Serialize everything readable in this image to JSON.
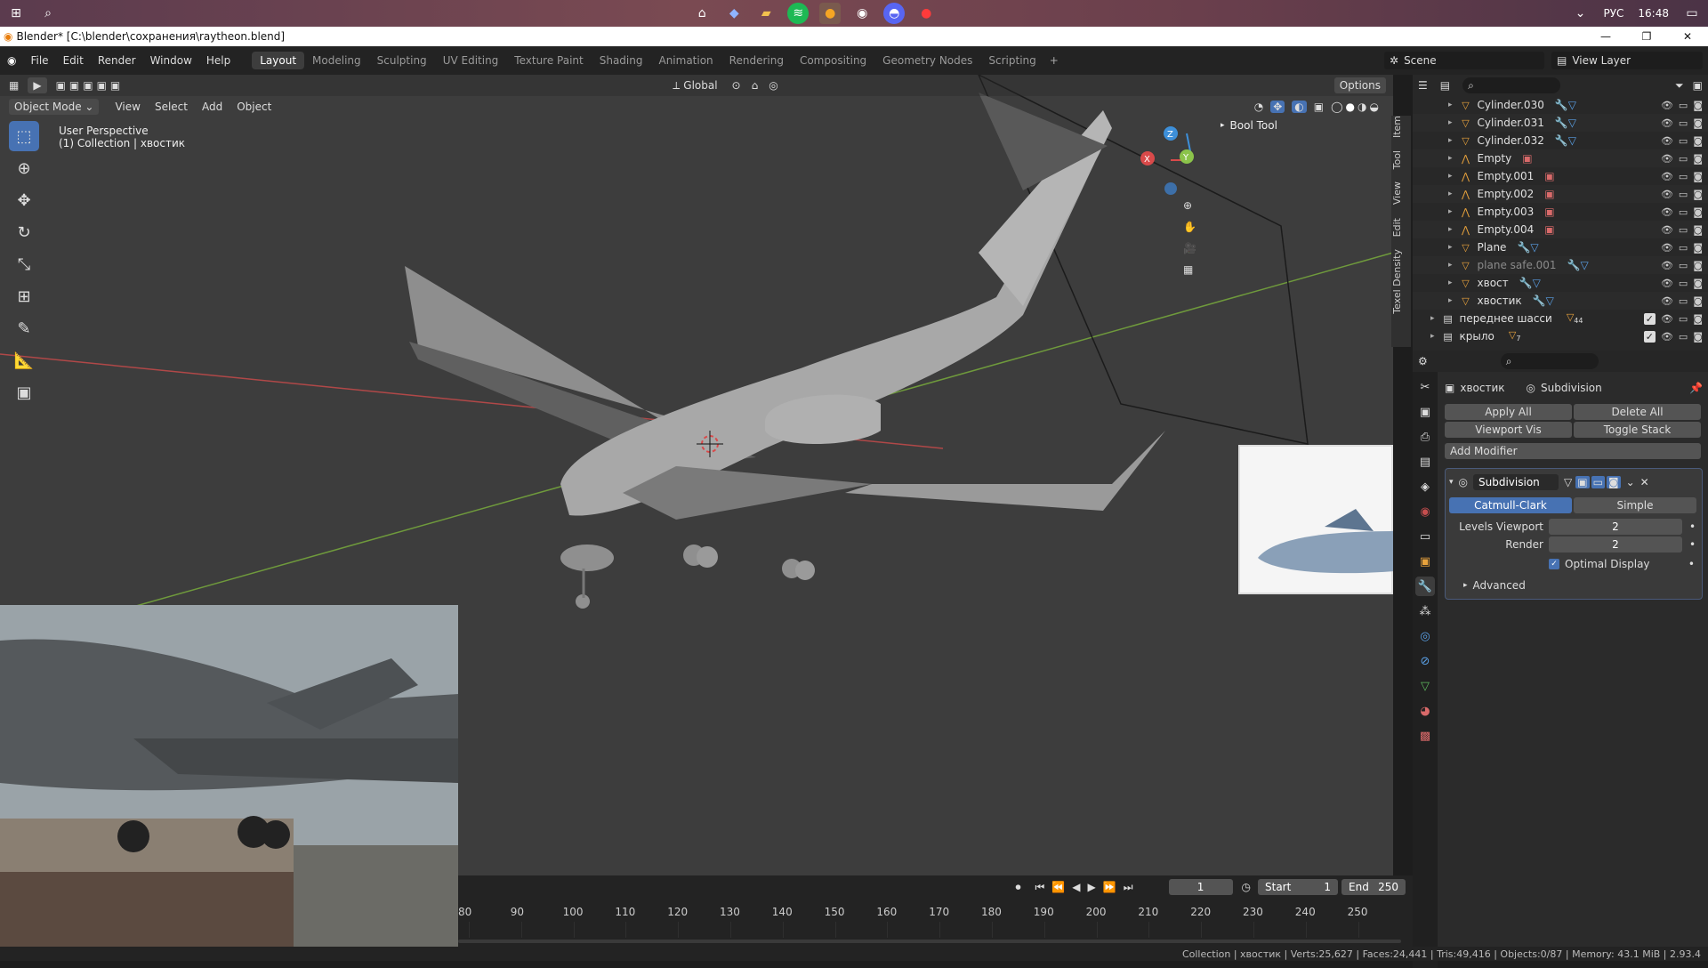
{
  "taskbar": {
    "lang": "РУС",
    "time": "16:48"
  },
  "window": {
    "title": "Blender* [C:\\blender\\сохранения\\raytheon.blend]"
  },
  "menu": [
    "File",
    "Edit",
    "Render",
    "Window",
    "Help"
  ],
  "workspaces": [
    "Layout",
    "Modeling",
    "Sculpting",
    "UV Editing",
    "Texture Paint",
    "Shading",
    "Animation",
    "Rendering",
    "Compositing",
    "Geometry Nodes",
    "Scripting"
  ],
  "scene": {
    "scene_name": "Scene",
    "view_layer": "View Layer"
  },
  "viewport": {
    "transform": "Global",
    "options": "Options",
    "mode": "Object Mode",
    "menu": [
      "View",
      "Select",
      "Add",
      "Object"
    ],
    "info_line1": "User Perspective",
    "info_line2": "(1) Collection | хвостик",
    "bool_tool": "Bool Tool",
    "side_tabs": [
      "Item",
      "Tool",
      "View",
      "Edit",
      "Texel Density"
    ],
    "gizmo": {
      "x": "X",
      "y": "Y",
      "z": "Z"
    }
  },
  "outliner": {
    "rows": [
      {
        "name": "Cylinder.030",
        "type": "mesh"
      },
      {
        "name": "Cylinder.031",
        "type": "mesh"
      },
      {
        "name": "Cylinder.032",
        "type": "mesh"
      },
      {
        "name": "Empty",
        "type": "empty"
      },
      {
        "name": "Empty.001",
        "type": "empty"
      },
      {
        "name": "Empty.002",
        "type": "empty"
      },
      {
        "name": "Empty.003",
        "type": "empty"
      },
      {
        "name": "Empty.004",
        "type": "empty"
      },
      {
        "name": "Plane",
        "type": "mesh"
      },
      {
        "name": "plane safe.001",
        "type": "mesh"
      },
      {
        "name": "хвост",
        "type": "mesh"
      },
      {
        "name": "хвостик",
        "type": "mesh"
      }
    ],
    "collections": [
      {
        "name": "переднее шасси",
        "badge": "44"
      },
      {
        "name": "крыло",
        "badge": "7"
      }
    ]
  },
  "properties": {
    "object": "хвостик",
    "modifier_context": "Subdivision",
    "apply_all": "Apply All",
    "delete_all": "Delete All",
    "viewport_vis": "Viewport Vis",
    "toggle_stack": "Toggle Stack",
    "add_modifier": "Add Modifier",
    "modifier_name": "Subdivision",
    "catmull": "Catmull-Clark",
    "simple": "Simple",
    "levels_viewport_label": "Levels Viewport",
    "levels_viewport": "2",
    "render_label": "Render",
    "render": "2",
    "optimal_display": "Optimal Display",
    "advanced": "Advanced"
  },
  "timeline": {
    "current_frame": "1",
    "start_label": "Start",
    "start": "1",
    "end_label": "End",
    "end": "250",
    "ticks": [
      "80",
      "90",
      "100",
      "110",
      "120",
      "130",
      "140",
      "150",
      "160",
      "170",
      "180",
      "190",
      "200",
      "210",
      "220",
      "230",
      "240",
      "250"
    ]
  },
  "status": "Collection | хвостик | Verts:25,627 | Faces:24,441 | Tris:49,416 | Objects:0/87 | Memory: 43.1 MiB | 2.93.4",
  "colors": {
    "accent": "#4772b3",
    "grid": "#3d3d3d",
    "mesh": "#a8a8a8",
    "x_axis": "#d94a4a",
    "y_axis": "#8bc34a",
    "z_axis": "#3d8fd9"
  }
}
